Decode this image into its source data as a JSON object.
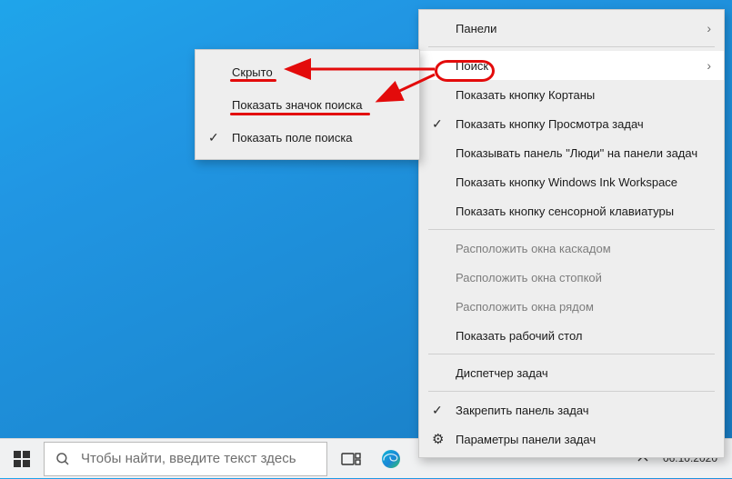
{
  "taskbar": {
    "search_placeholder": "Чтобы найти, введите текст здесь",
    "clock": {
      "date": "06.10.2020"
    }
  },
  "main_menu": {
    "panels": "Панели",
    "search": "Поиск",
    "cortana_button": "Показать кнопку Кортаны",
    "task_view_button": "Показать кнопку Просмотра задач",
    "people_panel": "Показывать панель \"Люди\" на панели задач",
    "ink_workspace": "Показать кнопку Windows Ink Workspace",
    "touch_keyboard": "Показать кнопку сенсорной клавиатуры",
    "cascade": "Расположить окна каскадом",
    "stacked": "Расположить окна стопкой",
    "side_by_side": "Расположить окна рядом",
    "show_desktop": "Показать рабочий стол",
    "task_manager": "Диспетчер задач",
    "lock_taskbar": "Закрепить панель задач",
    "taskbar_settings": "Параметры панели задач"
  },
  "sub_menu": {
    "hidden": "Скрыто",
    "show_icon": "Показать значок поиска",
    "show_box": "Показать поле поиска"
  },
  "icons": {
    "check": "✓",
    "chevron": "›",
    "gear": "⚙"
  }
}
